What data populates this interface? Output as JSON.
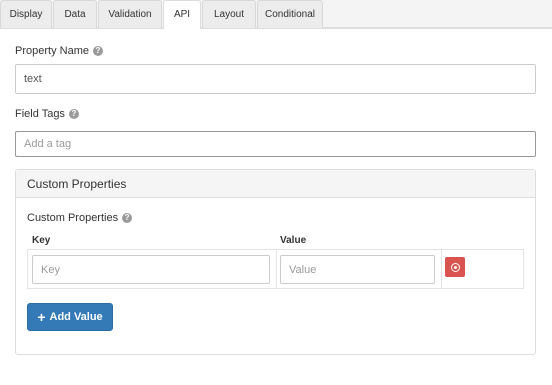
{
  "tabs": [
    {
      "label": "Display"
    },
    {
      "label": "Data"
    },
    {
      "label": "Validation"
    },
    {
      "label": "API"
    },
    {
      "label": "Layout"
    },
    {
      "label": "Conditional"
    }
  ],
  "active_tab": "API",
  "property_name": {
    "label": "Property Name",
    "value": "text"
  },
  "field_tags": {
    "label": "Field Tags",
    "placeholder": "Add a tag"
  },
  "custom_properties": {
    "panel_title": "Custom Properties",
    "label": "Custom Properties",
    "columns": {
      "key": "Key",
      "value": "Value"
    },
    "row": {
      "key_placeholder": "Key",
      "value_placeholder": "Value"
    },
    "add_button": "Add Value"
  },
  "icons": {
    "help": "question-circle-icon",
    "delete": "remove-circle-icon",
    "add": "plus-icon"
  },
  "colors": {
    "primary": "#337ab7",
    "danger": "#d9534f"
  }
}
